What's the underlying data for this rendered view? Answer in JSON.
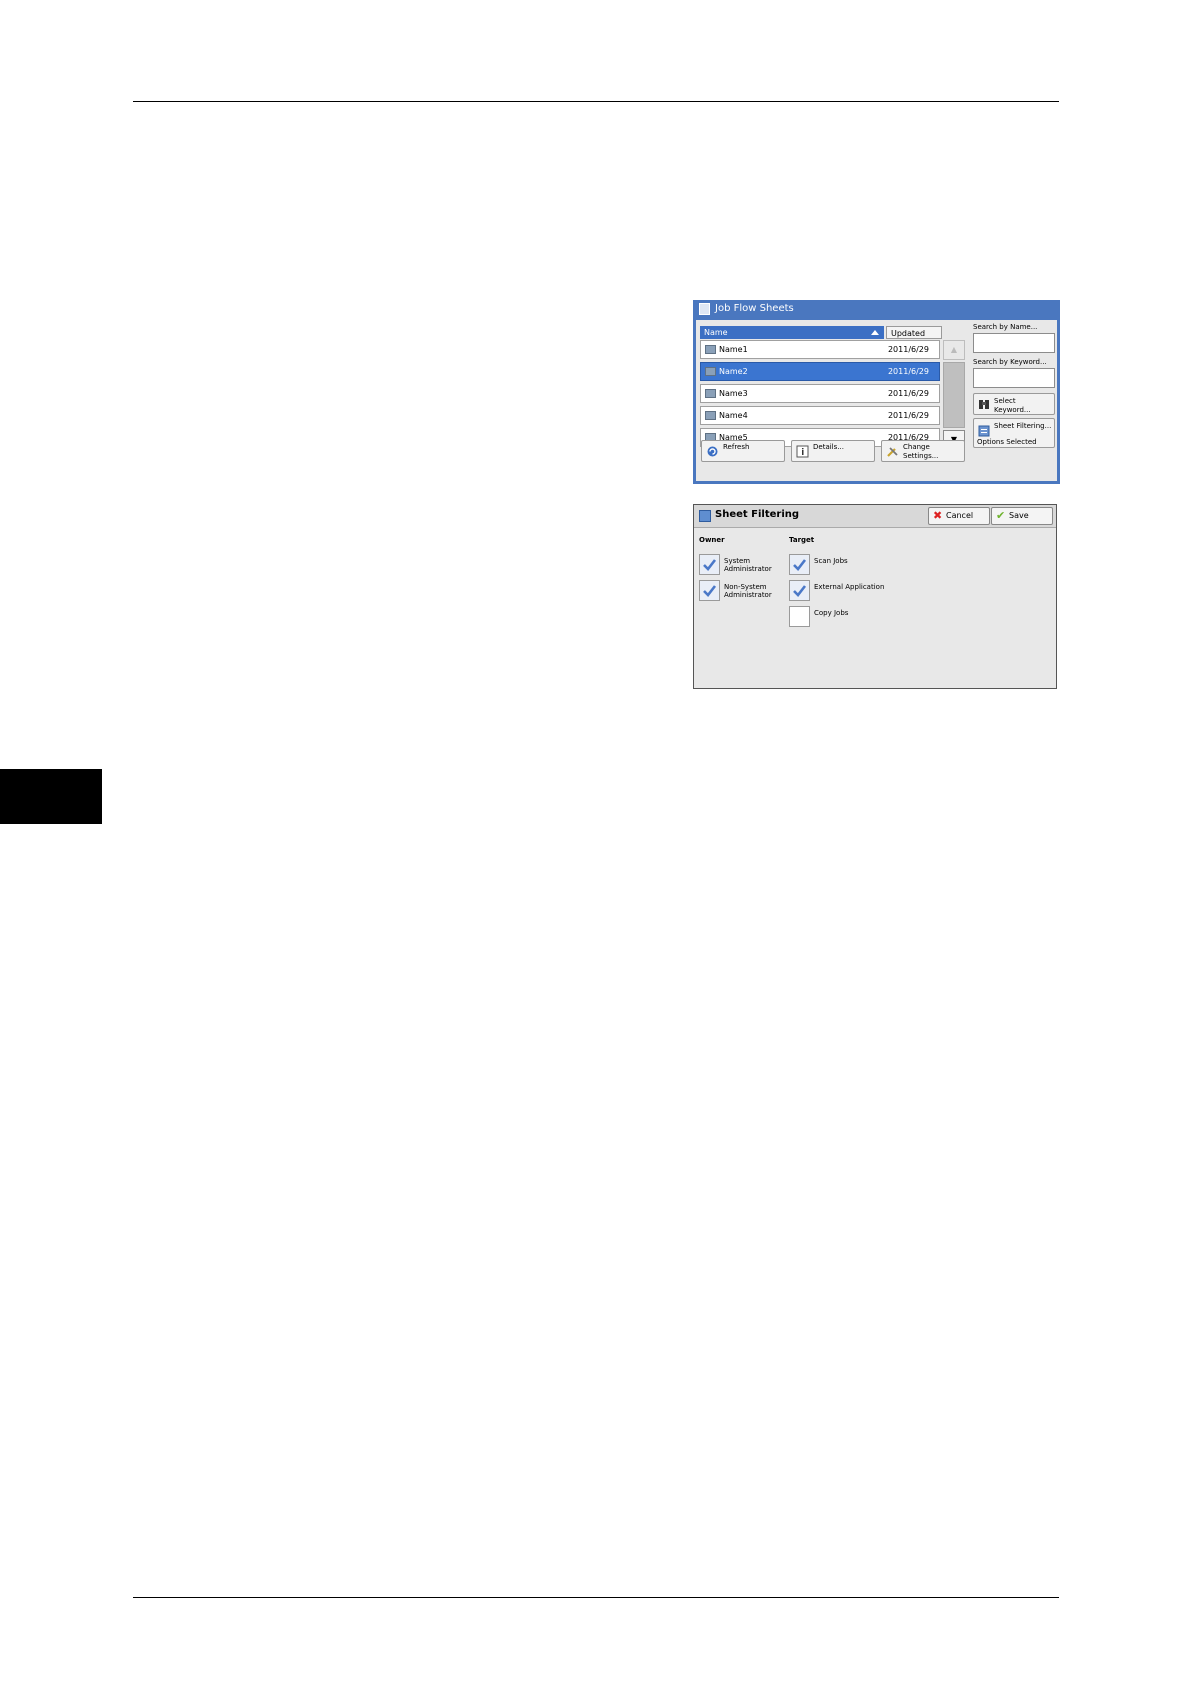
{
  "job_flow_sheets": {
    "title": "Job Flow Sheets",
    "columns": {
      "name": "Name",
      "updated": "Updated"
    },
    "rows": [
      {
        "name": "Name1",
        "date": "2011/6/29",
        "selected": false
      },
      {
        "name": "Name2",
        "date": "2011/6/29",
        "selected": true
      },
      {
        "name": "Name3",
        "date": "2011/6/29",
        "selected": false
      },
      {
        "name": "Name4",
        "date": "2011/6/29",
        "selected": false
      },
      {
        "name": "Name5",
        "date": "2011/6/29",
        "selected": false
      }
    ],
    "search_by_name": "Search by Name...",
    "search_by_keyword": "Search by Keyword...",
    "select_keyword": {
      "line1": "Select",
      "line2": "Keyword..."
    },
    "sheet_filtering": {
      "label": "Sheet Filtering...",
      "status": "Options Selected"
    },
    "refresh": "Refresh",
    "details": "Details...",
    "change_settings": {
      "line1": "Change",
      "line2": "Settings..."
    }
  },
  "sheet_filtering": {
    "title": "Sheet Filtering",
    "cancel": "Cancel",
    "save": "Save",
    "owner_label": "Owner",
    "target_label": "Target",
    "owner_options": [
      {
        "line1": "System",
        "line2": "Administrator",
        "checked": true
      },
      {
        "line1": "Non-System",
        "line2": "Administrator",
        "checked": true
      }
    ],
    "target_options": [
      {
        "label": "Scan Jobs",
        "checked": true
      },
      {
        "label": "External Application",
        "checked": true
      },
      {
        "label": "Copy Jobs",
        "checked": false
      }
    ]
  },
  "colors": {
    "titlebar": "#4a77bf",
    "selected_row": "#3b75d0",
    "panel_bg": "#e8e8e8"
  }
}
